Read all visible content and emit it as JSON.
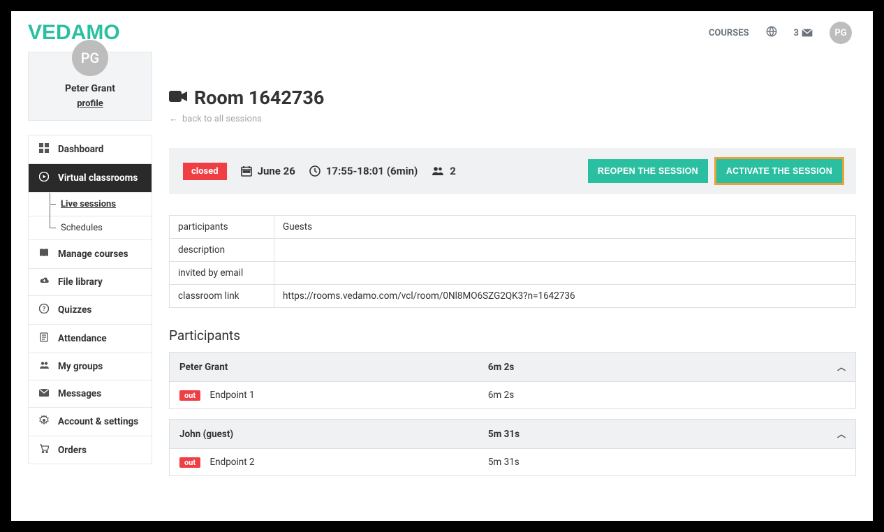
{
  "header": {
    "logo": "VEDAMO",
    "courses_label": "COURSES",
    "notification_count": "3",
    "avatar_initials": "PG"
  },
  "profile": {
    "avatar_initials": "PG",
    "name": "Peter Grant",
    "profile_link": "profile"
  },
  "nav": {
    "dashboard": "Dashboard",
    "virtual_classrooms": "Virtual classrooms",
    "live_sessions": "Live sessions",
    "schedules": "Schedules",
    "manage_courses": "Manage courses",
    "file_library": "File library",
    "quizzes": "Quizzes",
    "attendance": "Attendance",
    "my_groups": "My groups",
    "messages": "Messages",
    "account_settings": "Account & settings",
    "orders": "Orders"
  },
  "page": {
    "title": "Room 1642736",
    "back_link": "back to all sessions"
  },
  "status": {
    "badge": "closed",
    "date": "June 26",
    "time": "17:55-18:01 (6min)",
    "participants": "2",
    "reopen_btn": "REOPEN THE SESSION",
    "activate_btn": "ACTIVATE THE SESSION"
  },
  "info": {
    "participants_label": "participants",
    "participants_value": "Guests",
    "description_label": "description",
    "description_value": "",
    "invited_label": "invited by email",
    "invited_value": "",
    "link_label": "classroom link",
    "link_value": "https://rooms.vedamo.com/vcl/room/0Nl8MO6SZG2QK3?n=1642736"
  },
  "participants_section": {
    "title": "Participants",
    "rows": [
      {
        "name": "Peter Grant",
        "total": "6m 2s",
        "endpoint_badge": "out",
        "endpoint_label": "Endpoint 1",
        "endpoint_time": "6m 2s"
      },
      {
        "name": "John (guest)",
        "total": "5m 31s",
        "endpoint_badge": "out",
        "endpoint_label": "Endpoint 2",
        "endpoint_time": "5m 31s"
      }
    ]
  }
}
